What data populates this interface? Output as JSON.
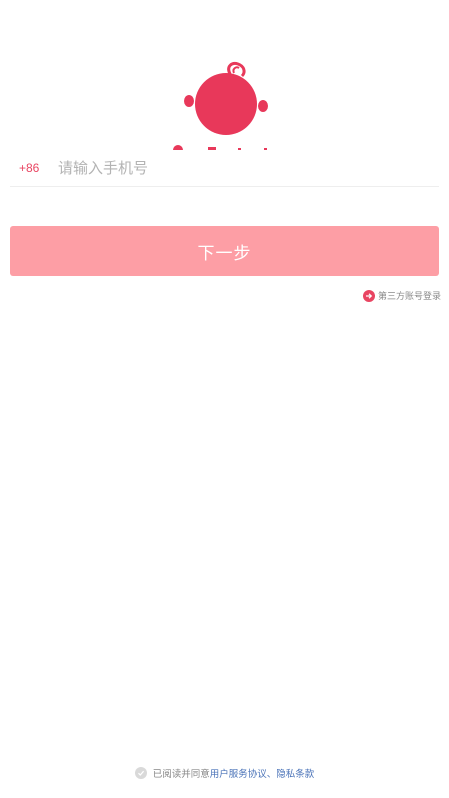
{
  "login": {
    "country_code": "+86",
    "phone_placeholder": "请输入手机号",
    "next_label": "下一步",
    "third_party_label": "第三方账号登录"
  },
  "agreement": {
    "prefix": "已阅读并同意",
    "terms_link": "用户服务协议",
    "separator": "、",
    "privacy_link": "隐私条款"
  },
  "colors": {
    "brand": "#e94562",
    "button_disabled": "#fd9ea5",
    "link": "#4a73b8"
  },
  "icons": [
    "app-logo-icon",
    "arrow-right-circle-icon",
    "check-circle-icon"
  ]
}
